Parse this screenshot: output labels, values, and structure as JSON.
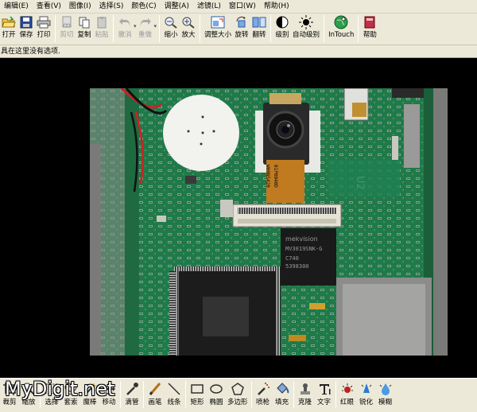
{
  "menu": [
    "编辑(E)",
    "查看(V)",
    "图像(I)",
    "选择(S)",
    "颜色(C)",
    "调整(A)",
    "滤镜(L)",
    "窗口(W)",
    "帮助(H)"
  ],
  "toolbar": {
    "open": "打开",
    "save": "保存",
    "print": "打印",
    "cut": "剪切",
    "copy": "复制",
    "paste": "粘贴",
    "undo": "撤消",
    "redo": "重做",
    "zoom_out": "缩小",
    "zoom_in": "放大",
    "resize": "调整大小",
    "rotate": "旋转",
    "flip": "翻转",
    "levels": "级别",
    "auto_levels": "自动级别",
    "intouch": "InTouch",
    "help": "帮助"
  },
  "hint": "具在这里没有选项.",
  "photo_text": {
    "chip_brand": "mekvision",
    "chip_model": "MV3019SNK-G",
    "chip_line3": "C740",
    "chip_line4": "5398300",
    "flex_label": "01P0040D",
    "flex_label2": "W00N5420",
    "board_label": "U2"
  },
  "bottom": {
    "crop": "裁剪",
    "zoom": "缩放",
    "select": "选择",
    "lasso": "套索",
    "wand": "魔棒",
    "move": "移动",
    "eyedropper": "滴管",
    "pencil": "画笔",
    "line": "线条",
    "rect": "矩形",
    "ellipse": "椭圆",
    "polygon": "多边形",
    "spray": "喷枪",
    "fill": "填充",
    "clone": "克隆",
    "text": "文字",
    "redeye": "红眼",
    "sharpen": "锐化",
    "blur": "模糊"
  },
  "watermark": "MyDigit.net",
  "colors": {
    "chrome": "#ece9d8",
    "pcb": "#1f7a4a",
    "background": "#000000"
  }
}
